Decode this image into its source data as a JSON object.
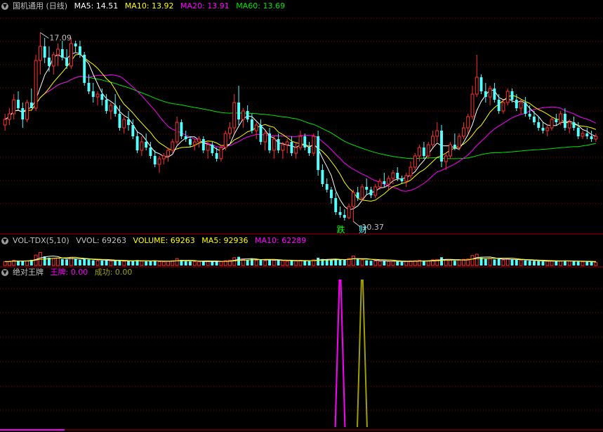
{
  "colors": {
    "background": "#000000",
    "up": "#ff3232",
    "down": "#54ffff",
    "ma5": "#ffffff",
    "ma10": "#ffff00",
    "ma20": "#ff00ff",
    "ma60": "#00e600",
    "grid": "#8b0000",
    "label_gray": "#c0c0c0",
    "wangpai": "#ff00ff",
    "chenggong": "#a0a000",
    "signal_die": "#00ff00",
    "signal_cai": "#54ffff"
  },
  "price_panel": {
    "toggle_icon": "circle-caret-down-icon",
    "title": "国机通用 (日线)",
    "ma5_label": "MA5: 14.51",
    "ma10_label": "MA10: 13.92",
    "ma20_label": "MA20: 13.91",
    "ma60_label": "MA60: 13.69",
    "high_label": "17.09",
    "low_label": "10.37",
    "signal_1": "跌",
    "signal_2": "财"
  },
  "volume_panel": {
    "toggle_icon": "circle-caret-down-icon",
    "title": "VOL-TDX(5,10)",
    "vvol_label": "VVOL: 69263",
    "volume_label": "VOLUME: 69263",
    "ma5_label": "MA5: 92936",
    "ma10_label": "MA10: 62289"
  },
  "indicator_panel": {
    "toggle_icon": "circle-caret-down-icon",
    "title": "绝对王牌",
    "wangpai_label": "王牌: 0.00",
    "chenggong_label": "成功: 0.00"
  },
  "chart_data": [
    {
      "type": "candlestick",
      "title": "国机通用 (日线)",
      "ylim": [
        10.0,
        17.8
      ],
      "annotations": [
        {
          "text": "17.09",
          "index": 8,
          "value": 17.09
        },
        {
          "text": "10.37",
          "index": 79,
          "value": 10.37
        },
        {
          "text": "跌",
          "index": 76
        },
        {
          "text": "财",
          "index": 81
        }
      ],
      "series": [
        {
          "name": "MA5",
          "last": 14.51
        },
        {
          "name": "MA10",
          "last": 13.92
        },
        {
          "name": "MA20",
          "last": 13.91
        },
        {
          "name": "MA60",
          "last": 13.69
        }
      ],
      "ohlc": [
        [
          13.8,
          14.2,
          13.6,
          14.0
        ],
        [
          14.0,
          14.4,
          13.8,
          14.2
        ],
        [
          14.2,
          14.9,
          14.0,
          14.7
        ],
        [
          14.7,
          15.0,
          14.3,
          14.4
        ],
        [
          14.4,
          14.6,
          13.7,
          14.0
        ],
        [
          14.0,
          14.7,
          13.9,
          14.6
        ],
        [
          14.6,
          15.1,
          14.4,
          14.4
        ],
        [
          14.4,
          16.3,
          14.3,
          16.1
        ],
        [
          16.1,
          17.09,
          15.6,
          16.6
        ],
        [
          16.6,
          16.9,
          16.0,
          16.2
        ],
        [
          16.2,
          16.6,
          15.7,
          15.9
        ],
        [
          15.9,
          16.4,
          15.6,
          16.3
        ],
        [
          16.3,
          16.7,
          15.9,
          16.5
        ],
        [
          16.5,
          16.8,
          16.1,
          16.2
        ],
        [
          16.2,
          16.5,
          15.8,
          15.9
        ],
        [
          15.9,
          16.9,
          15.8,
          16.7
        ],
        [
          16.7,
          16.8,
          16.4,
          16.6
        ],
        [
          16.6,
          16.8,
          16.2,
          16.3
        ],
        [
          16.3,
          16.4,
          15.2,
          15.3
        ],
        [
          15.3,
          15.6,
          14.9,
          15.0
        ],
        [
          15.0,
          15.3,
          14.6,
          14.8
        ],
        [
          14.8,
          15.0,
          14.5,
          14.9
        ],
        [
          14.9,
          15.1,
          14.5,
          14.7
        ],
        [
          14.7,
          14.9,
          14.2,
          14.3
        ],
        [
          14.3,
          14.6,
          14.0,
          14.5
        ],
        [
          14.5,
          14.9,
          14.1,
          14.2
        ],
        [
          14.2,
          14.5,
          13.6,
          13.7
        ],
        [
          13.7,
          14.1,
          13.5,
          14.0
        ],
        [
          14.0,
          14.3,
          13.6,
          13.8
        ],
        [
          13.8,
          14.0,
          13.3,
          13.4
        ],
        [
          13.4,
          13.6,
          12.8,
          12.9
        ],
        [
          12.9,
          13.4,
          12.7,
          13.2
        ],
        [
          13.2,
          13.5,
          12.9,
          13.0
        ],
        [
          13.0,
          13.2,
          12.6,
          12.7
        ],
        [
          12.7,
          12.9,
          12.3,
          12.4
        ],
        [
          12.4,
          12.7,
          12.1,
          12.6
        ],
        [
          12.6,
          12.8,
          12.4,
          12.7
        ],
        [
          12.7,
          13.0,
          12.5,
          12.9
        ],
        [
          12.9,
          13.3,
          12.8,
          13.2
        ],
        [
          13.2,
          14.1,
          13.1,
          13.9
        ],
        [
          13.9,
          14.0,
          13.3,
          13.4
        ],
        [
          13.4,
          13.6,
          13.2,
          13.3
        ],
        [
          13.3,
          13.4,
          13.0,
          13.1
        ],
        [
          13.1,
          13.3,
          12.9,
          13.2
        ],
        [
          13.2,
          13.4,
          13.0,
          13.3
        ],
        [
          13.3,
          13.4,
          12.8,
          12.9
        ],
        [
          12.9,
          13.2,
          12.6,
          13.1
        ],
        [
          13.1,
          13.2,
          12.7,
          12.8
        ],
        [
          12.8,
          13.0,
          12.5,
          12.6
        ],
        [
          12.6,
          13.1,
          12.5,
          13.0
        ],
        [
          13.0,
          13.6,
          12.9,
          13.5
        ],
        [
          13.5,
          13.9,
          13.3,
          13.7
        ],
        [
          13.7,
          14.9,
          13.5,
          14.6
        ],
        [
          14.6,
          15.2,
          13.8,
          14.0
        ],
        [
          14.0,
          14.4,
          13.7,
          14.3
        ],
        [
          14.3,
          14.5,
          13.9,
          14.0
        ],
        [
          14.0,
          14.2,
          13.5,
          13.6
        ],
        [
          13.6,
          13.9,
          13.3,
          13.8
        ],
        [
          13.8,
          14.0,
          13.1,
          13.2
        ],
        [
          13.2,
          13.6,
          12.9,
          13.5
        ],
        [
          13.5,
          13.7,
          12.8,
          12.9
        ],
        [
          12.9,
          13.4,
          12.6,
          13.3
        ],
        [
          13.3,
          13.5,
          12.8,
          12.9
        ],
        [
          12.9,
          13.2,
          12.6,
          13.1
        ],
        [
          13.1,
          13.3,
          12.8,
          13.2
        ],
        [
          13.2,
          13.4,
          12.7,
          12.8
        ],
        [
          12.8,
          13.2,
          12.6,
          13.0
        ],
        [
          13.0,
          13.6,
          12.9,
          13.4
        ],
        [
          13.4,
          13.5,
          12.9,
          13.0
        ],
        [
          13.0,
          13.2,
          12.7,
          12.8
        ],
        [
          12.8,
          13.5,
          12.7,
          13.4
        ],
        [
          13.4,
          13.6,
          12.0,
          12.2
        ],
        [
          12.2,
          12.4,
          11.6,
          11.7
        ],
        [
          11.7,
          11.9,
          11.4,
          11.5
        ],
        [
          11.5,
          11.6,
          11.0,
          11.2
        ],
        [
          11.2,
          11.4,
          10.6,
          10.7
        ],
        [
          10.7,
          10.9,
          10.5,
          10.6
        ],
        [
          10.6,
          10.8,
          10.4,
          10.5
        ],
        [
          10.5,
          11.0,
          10.45,
          10.9
        ],
        [
          10.9,
          11.5,
          10.37,
          11.4
        ],
        [
          11.4,
          11.6,
          11.1,
          11.2
        ],
        [
          11.2,
          11.7,
          11.1,
          11.6
        ],
        [
          11.6,
          11.9,
          11.3,
          11.5
        ],
        [
          11.5,
          11.6,
          11.2,
          11.3
        ],
        [
          11.3,
          11.7,
          11.2,
          11.6
        ],
        [
          11.6,
          11.9,
          11.5,
          11.8
        ],
        [
          11.8,
          12.1,
          11.6,
          11.7
        ],
        [
          11.7,
          12.0,
          11.5,
          11.9
        ],
        [
          11.9,
          12.2,
          11.7,
          12.1
        ],
        [
          12.1,
          12.3,
          11.8,
          11.9
        ],
        [
          11.9,
          12.0,
          11.7,
          11.8
        ],
        [
          11.8,
          12.1,
          11.6,
          12.0
        ],
        [
          12.0,
          12.5,
          11.9,
          12.3
        ],
        [
          12.3,
          12.8,
          12.2,
          12.7
        ],
        [
          12.7,
          13.1,
          12.5,
          13.0
        ],
        [
          13.0,
          13.2,
          12.6,
          12.7
        ],
        [
          12.7,
          13.2,
          12.6,
          13.1
        ],
        [
          13.1,
          13.6,
          13.0,
          13.4
        ],
        [
          13.4,
          13.9,
          13.2,
          13.6
        ],
        [
          13.6,
          13.8,
          12.3,
          12.5
        ],
        [
          12.5,
          12.8,
          12.2,
          12.7
        ],
        [
          12.7,
          13.2,
          12.6,
          13.1
        ],
        [
          13.1,
          13.5,
          12.9,
          13.0
        ],
        [
          13.0,
          13.5,
          12.9,
          13.4
        ],
        [
          13.4,
          13.9,
          13.3,
          13.7
        ],
        [
          13.7,
          14.2,
          13.5,
          14.1
        ],
        [
          14.1,
          15.2,
          14.0,
          14.9
        ],
        [
          14.9,
          16.3,
          14.8,
          15.5
        ],
        [
          15.5,
          15.6,
          14.9,
          15.0
        ],
        [
          15.0,
          15.3,
          14.6,
          14.8
        ],
        [
          14.8,
          15.2,
          14.5,
          15.1
        ],
        [
          15.1,
          15.3,
          14.6,
          14.7
        ],
        [
          14.7,
          14.9,
          14.2,
          14.3
        ],
        [
          14.3,
          14.7,
          14.2,
          14.6
        ],
        [
          14.6,
          15.1,
          14.5,
          15.0
        ],
        [
          15.0,
          15.1,
          14.6,
          14.7
        ],
        [
          14.7,
          14.9,
          14.3,
          14.4
        ],
        [
          14.4,
          14.7,
          14.2,
          14.6
        ],
        [
          14.6,
          14.8,
          14.1,
          14.2
        ],
        [
          14.2,
          14.5,
          14.0,
          14.1
        ],
        [
          14.1,
          14.3,
          13.8,
          13.9
        ],
        [
          13.9,
          14.1,
          13.6,
          13.7
        ],
        [
          13.7,
          13.9,
          13.5,
          13.6
        ],
        [
          13.6,
          13.8,
          13.4,
          13.7
        ],
        [
          13.7,
          14.1,
          13.6,
          14.0
        ],
        [
          14.0,
          14.2,
          13.8,
          13.9
        ],
        [
          13.9,
          14.3,
          13.8,
          14.2
        ],
        [
          14.2,
          14.4,
          13.6,
          13.7
        ],
        [
          13.7,
          14.0,
          13.5,
          13.9
        ],
        [
          13.9,
          14.1,
          13.6,
          13.7
        ],
        [
          13.7,
          13.9,
          13.3,
          13.4
        ],
        [
          13.4,
          13.6,
          13.3,
          13.5
        ],
        [
          13.5,
          13.7,
          13.3,
          13.4
        ],
        [
          13.4,
          13.6,
          13.2,
          13.3
        ],
        [
          13.3,
          13.5,
          13.2,
          13.4
        ]
      ]
    },
    {
      "type": "bar",
      "title": "VOL-TDX(5,10)",
      "series": [
        {
          "name": "VVOL",
          "last": 69263
        },
        {
          "name": "VOLUME",
          "last": 69263
        },
        {
          "name": "MA5",
          "last": 92936
        },
        {
          "name": "MA10",
          "last": 62289
        }
      ],
      "ylim": [
        0,
        420000
      ],
      "volume": [
        90000,
        95000,
        120000,
        110000,
        100000,
        105000,
        130000,
        240000,
        300000,
        210000,
        180000,
        160000,
        170000,
        150000,
        140000,
        190000,
        150000,
        130000,
        160000,
        140000,
        120000,
        110000,
        115000,
        130000,
        100000,
        105000,
        120000,
        95000,
        100000,
        110000,
        125000,
        100000,
        95000,
        105000,
        115000,
        90000,
        85000,
        95000,
        110000,
        160000,
        130000,
        100000,
        95000,
        90000,
        85000,
        100000,
        95000,
        90000,
        100000,
        90000,
        110000,
        120000,
        180000,
        200000,
        140000,
        130000,
        150000,
        120000,
        140000,
        110000,
        130000,
        120000,
        125000,
        110000,
        100000,
        115000,
        105000,
        120000,
        110000,
        100000,
        130000,
        180000,
        150000,
        140000,
        130000,
        150000,
        140000,
        130000,
        160000,
        220000,
        150000,
        130000,
        120000,
        110000,
        105000,
        100000,
        110000,
        95000,
        100000,
        90000,
        85000,
        95000,
        105000,
        110000,
        120000,
        100000,
        110000,
        130000,
        140000,
        190000,
        130000,
        120000,
        110000,
        125000,
        140000,
        150000,
        230000,
        260000,
        180000,
        150000,
        160000,
        140000,
        150000,
        130000,
        150000,
        140000,
        130000,
        125000,
        120000,
        110000,
        105000,
        100000,
        95000,
        100000,
        110000,
        100000,
        105000,
        115000,
        100000,
        95000,
        90000,
        85000,
        90000,
        80000,
        69263
      ]
    },
    {
      "type": "line",
      "title": "绝对王牌",
      "series": [
        {
          "name": "王牌",
          "last": 0.0,
          "spike_index": 76
        },
        {
          "name": "成功",
          "last": 0.0,
          "spike_index": 81
        }
      ]
    }
  ]
}
